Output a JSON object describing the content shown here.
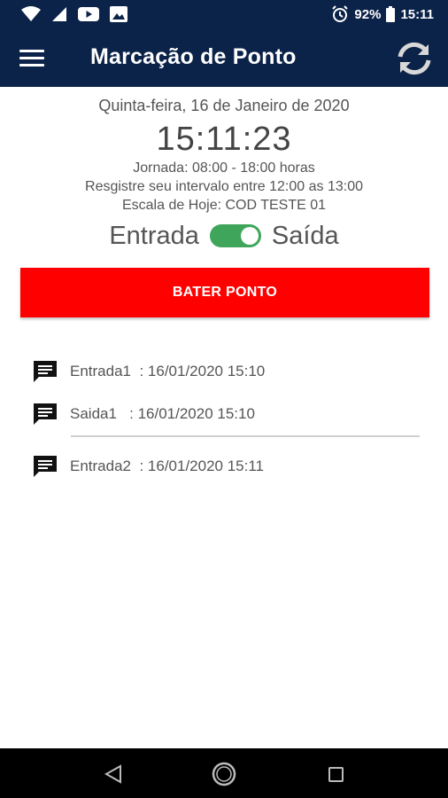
{
  "status_bar": {
    "battery": "92%",
    "time": "15:11",
    "icons": [
      "wifi-icon",
      "signal-icon",
      "youtube-icon",
      "gallery-icon",
      "alarm-icon",
      "battery-icon"
    ]
  },
  "app_bar": {
    "title": "Marcação de Ponto",
    "menu_icon": "menu-icon",
    "refresh_icon": "refresh-icon"
  },
  "header_info": {
    "date": "Quinta-feira, 16 de Janeiro de 2020",
    "clock": "15:11:23",
    "jornada": "Jornada: 08:00 - 18:00 horas",
    "intervalo": "Resgistre seu intervalo entre 12:00 as 13:00",
    "escala": "Escala de Hoje: COD TESTE 01"
  },
  "toggle": {
    "left_label": "Entrada",
    "right_label": "Saída",
    "state": "on"
  },
  "action": {
    "button_label": "BATER PONTO"
  },
  "records": [
    {
      "label": "Entrada1",
      "separator": "  : ",
      "value": "16/01/2020 15:10"
    },
    {
      "label": "Saida1",
      "separator": "   : ",
      "value": "16/01/2020 15:10"
    },
    {
      "label": "Entrada2",
      "separator": "  : ",
      "value": "16/01/2020 15:11"
    }
  ],
  "colors": {
    "app_bar": "#0b2249",
    "action_button": "#ff0000",
    "switch_on": "#3fa55a"
  }
}
